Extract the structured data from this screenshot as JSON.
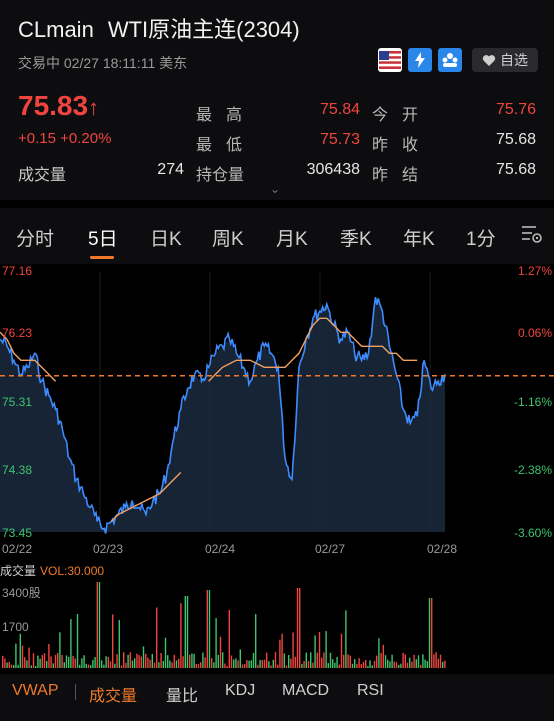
{
  "header": {
    "symbol": "CLmain",
    "name": "WTI原油主连(2304)",
    "status": "交易中 02/27 18:11:11 美东",
    "watch_label": "自选",
    "icons": [
      "us-flag-icon",
      "lightning-icon",
      "people-icon",
      "heart-icon"
    ]
  },
  "quote": {
    "price": "75.83",
    "price_arrow": "↑",
    "change": "+0.15",
    "change_pct": "+0.20%",
    "volume_label": "成交量",
    "volume": "274",
    "stats": [
      {
        "label": "最高",
        "value": "75.84",
        "color": "#f0453f"
      },
      {
        "label": "最低",
        "value": "75.73",
        "color": "#f0453f"
      },
      {
        "label": "持仓量",
        "value": "306438",
        "color": "#e6e6e6"
      },
      {
        "label": "今开",
        "value": "75.76",
        "color": "#f0453f"
      },
      {
        "label": "昨收",
        "value": "75.68",
        "color": "#e6e6e6"
      },
      {
        "label": "昨结",
        "value": "75.68",
        "color": "#e6e6e6"
      }
    ]
  },
  "tabs": [
    "分时",
    "5日",
    "日K",
    "周K",
    "月K",
    "季K",
    "年K",
    "1分"
  ],
  "active_tab": "5日",
  "chart_data": {
    "type": "line",
    "y_left_ticks": [
      "77.16",
      "76.23",
      "75.31",
      "74.38",
      "73.45"
    ],
    "y_right_ticks": [
      "1.27%",
      "0.06%",
      "-1.16%",
      "-2.38%",
      "-3.60%"
    ],
    "x_ticks": [
      "02/22",
      "02/23",
      "02/24",
      "02/27",
      "02/28"
    ],
    "ylim": [
      73.45,
      77.16
    ],
    "prev_close": 75.68,
    "series": [
      {
        "values": [
          76.2,
          76.1,
          75.9,
          75.7,
          75.8,
          76.0,
          75.6,
          75.4,
          75.2,
          74.9,
          74.5,
          74.2,
          74.0,
          73.8,
          73.6,
          73.5,
          73.6,
          73.7,
          73.8,
          73.9,
          73.8,
          73.7,
          73.9,
          74.0,
          74.3,
          74.8,
          75.2,
          75.5,
          75.7,
          75.6,
          75.8,
          76.0,
          76.1,
          76.2,
          76.0,
          75.8,
          75.6,
          75.9,
          76.1,
          76.0,
          75.8,
          74.5,
          74.2,
          75.8,
          76.2,
          76.5,
          76.6,
          76.7,
          76.4,
          76.2,
          76.3,
          76.0,
          75.9,
          76.0,
          76.8,
          76.6,
          76.1,
          75.7,
          75.2,
          75.0,
          75.1,
          75.9,
          75.5,
          75.6,
          75.7
        ]
      },
      {
        "values": [
          76.3,
          76.2,
          76.0,
          75.9,
          75.9,
          75.9,
          75.8,
          75.7,
          75.6,
          null,
          null,
          null,
          null,
          null,
          null,
          null,
          73.6,
          73.7,
          73.75,
          73.8,
          73.85,
          73.9,
          73.95,
          74.0,
          74.1,
          74.2,
          74.3,
          null,
          null,
          null,
          75.6,
          75.7,
          75.8,
          75.85,
          75.9,
          75.9,
          75.9,
          75.85,
          75.8,
          75.8,
          75.8,
          75.8,
          75.9,
          76.0,
          76.2,
          76.4,
          76.5,
          76.5,
          76.4,
          76.3,
          76.3,
          76.2,
          76.1,
          76.1,
          76.1,
          76.1,
          76.0,
          76.0,
          75.9,
          75.9,
          75.9,
          null,
          null,
          null,
          null
        ]
      }
    ]
  },
  "volume_panel": {
    "title": "成交量",
    "vol_text": "VOL:30.000",
    "ticks": [
      "3400股",
      "1700"
    ]
  },
  "indicators": [
    "VWAP",
    "成交量",
    "量比",
    "KDJ",
    "MACD",
    "RSI"
  ],
  "active_indicator": "成交量",
  "colors": {
    "up": "#f0453f",
    "down": "#3ec46d",
    "accent": "#f07a2a",
    "line": "#3d8cff",
    "avg": "#f0a060"
  }
}
